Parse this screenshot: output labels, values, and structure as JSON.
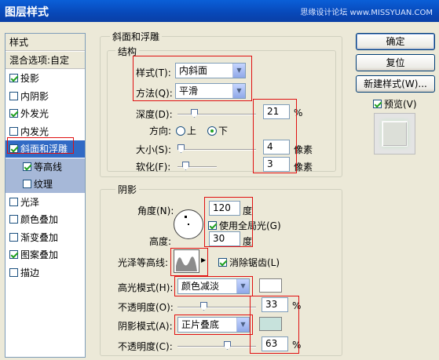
{
  "window": {
    "title": "图层样式",
    "watermark": "思缘设计论坛 www.MISSYUAN.COM"
  },
  "sidebar": {
    "header": "样式",
    "blend_options": "混合选项:自定",
    "items": [
      {
        "label": "投影",
        "checked": true
      },
      {
        "label": "内阴影",
        "checked": false
      },
      {
        "label": "外发光",
        "checked": true
      },
      {
        "label": "内发光",
        "checked": false
      },
      {
        "label": "斜面和浮雕",
        "checked": true
      },
      {
        "label": "等高线",
        "checked": true
      },
      {
        "label": "纹理",
        "checked": false
      },
      {
        "label": "光泽",
        "checked": false
      },
      {
        "label": "颜色叠加",
        "checked": false
      },
      {
        "label": "渐变叠加",
        "checked": false
      },
      {
        "label": "图案叠加",
        "checked": true
      },
      {
        "label": "描边",
        "checked": false
      }
    ]
  },
  "bevel": {
    "group_title": "斜面和浮雕",
    "structure_title": "结构",
    "style_label": "样式(T):",
    "style_value": "内斜面",
    "method_label": "方法(Q):",
    "method_value": "平滑",
    "depth_label": "深度(D):",
    "depth_value": "21",
    "depth_unit": "%",
    "direction_label": "方向:",
    "dir_up": "上",
    "dir_down": "下",
    "size_label": "大小(S):",
    "size_value": "4",
    "size_unit": "像素",
    "soften_label": "软化(F):",
    "soften_value": "3",
    "soften_unit": "像素"
  },
  "shading": {
    "title": "阴影",
    "angle_label": "角度(N):",
    "angle_value": "120",
    "angle_unit": "度",
    "global_light": "使用全局光(G)",
    "altitude_label": "高度:",
    "altitude_value": "30",
    "altitude_unit": "度",
    "gloss_label": "光泽等高线:",
    "antialias": "消除锯齿(L)",
    "highlight_label": "高光模式(H):",
    "highlight_mode": "颜色减淡",
    "highlight_color": "#ffffff",
    "opacity1_label": "不透明度(O):",
    "opacity1_value": "33",
    "opacity1_unit": "%",
    "shadow_label": "阴影模式(A):",
    "shadow_mode": "正片叠底",
    "shadow_color": "#c7e2dc",
    "opacity2_label": "不透明度(C):",
    "opacity2_value": "63",
    "opacity2_unit": "%"
  },
  "buttons": {
    "ok": "确定",
    "reset": "复位",
    "new_style": "新建样式(W)...",
    "preview": "预览(V)"
  },
  "levels": {
    "depth": 0.21,
    "size": 0.04,
    "soften": 0.19,
    "opacity1": 0.33,
    "opacity2": 0.63
  }
}
